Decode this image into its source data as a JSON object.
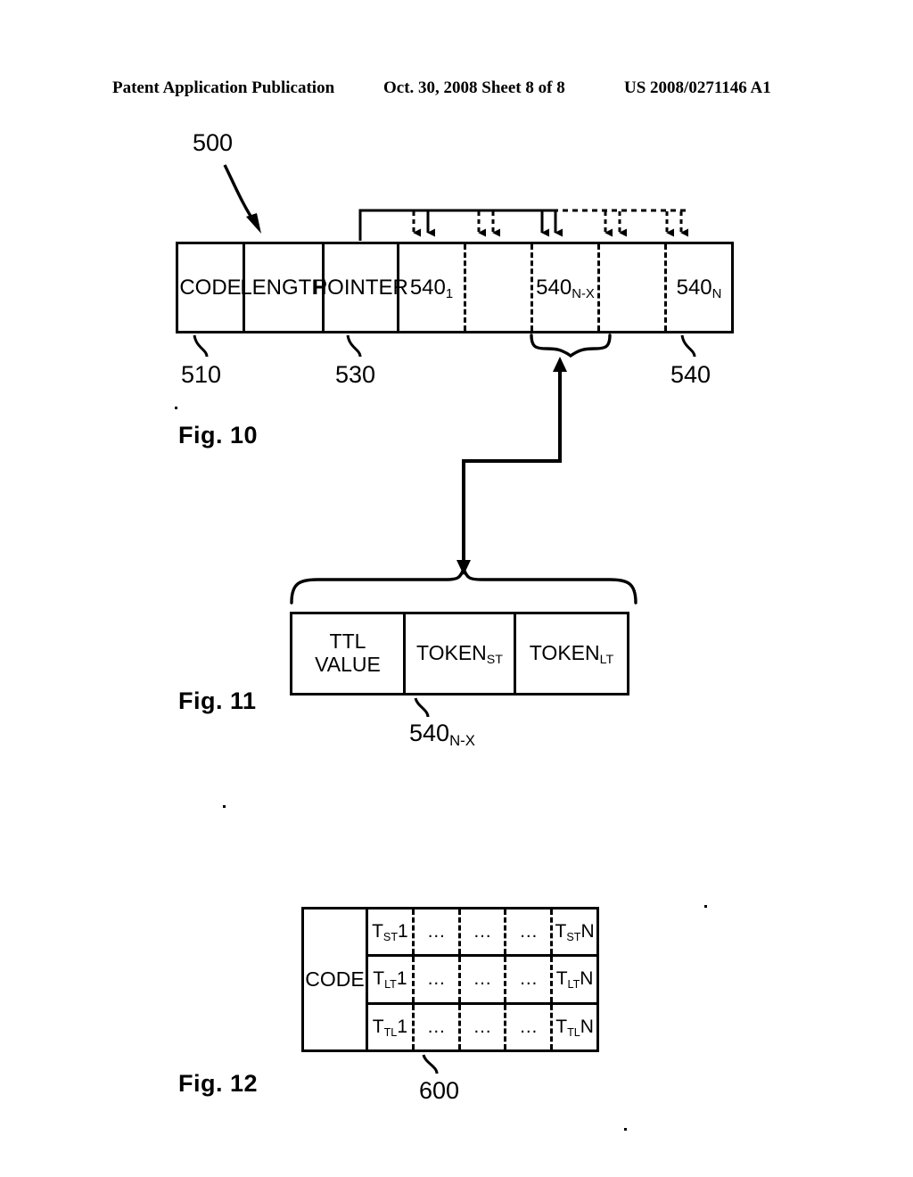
{
  "page_header": {
    "publication": "Patent Application Publication",
    "date_sheet": "Oct. 30, 2008   Sheet 8 of 8",
    "patent_number": "US 2008/0271146 A1"
  },
  "figures": [
    {
      "caption": "Fig. 10",
      "diagram_label": "500",
      "cells": [
        {
          "label": "CODE",
          "divider": "solid"
        },
        {
          "label": "LENGTH",
          "divider": "solid"
        },
        {
          "label": "POINTER",
          "divider": "solid"
        },
        {
          "label": "540",
          "sub": "1",
          "divider": "dashed"
        },
        {
          "label": "",
          "sub": "",
          "divider": "dashed"
        },
        {
          "label": "540",
          "sub": "N-X",
          "divider": "dashed"
        },
        {
          "label": "",
          "sub": "",
          "divider": "dashed"
        },
        {
          "label": "540",
          "sub": "N",
          "divider": "none"
        }
      ],
      "reference_numbers": [
        "510",
        "530",
        "540"
      ]
    },
    {
      "caption": "Fig. 11",
      "cells": [
        {
          "line1": "TTL",
          "line2": "VALUE"
        },
        {
          "line1": "TOKEN",
          "sub": "ST"
        },
        {
          "line1": "TOKEN",
          "sub": "LT"
        }
      ],
      "reference_number": "540",
      "reference_sub": "N-X"
    },
    {
      "caption": "Fig. 12",
      "code_label": "CODE",
      "rows": [
        [
          {
            "t": "T",
            "sub": "ST",
            "n": "1"
          },
          {
            "t": "…"
          },
          {
            "t": "…"
          },
          {
            "t": "…"
          },
          {
            "t": "T",
            "sub": "ST",
            "n": "N"
          }
        ],
        [
          {
            "t": "T",
            "sub": "LT",
            "n": "1"
          },
          {
            "t": "…"
          },
          {
            "t": "…"
          },
          {
            "t": "…"
          },
          {
            "t": "T",
            "sub": "LT",
            "n": "N"
          }
        ],
        [
          {
            "t": "T",
            "sub": "TL",
            "n": "1"
          },
          {
            "t": "…"
          },
          {
            "t": "…"
          },
          {
            "t": "…"
          },
          {
            "t": "T",
            "sub": "TL",
            "n": "N"
          }
        ]
      ],
      "reference_number": "600"
    }
  ],
  "colors": {
    "ink": "#000000",
    "paper": "#ffffff"
  }
}
